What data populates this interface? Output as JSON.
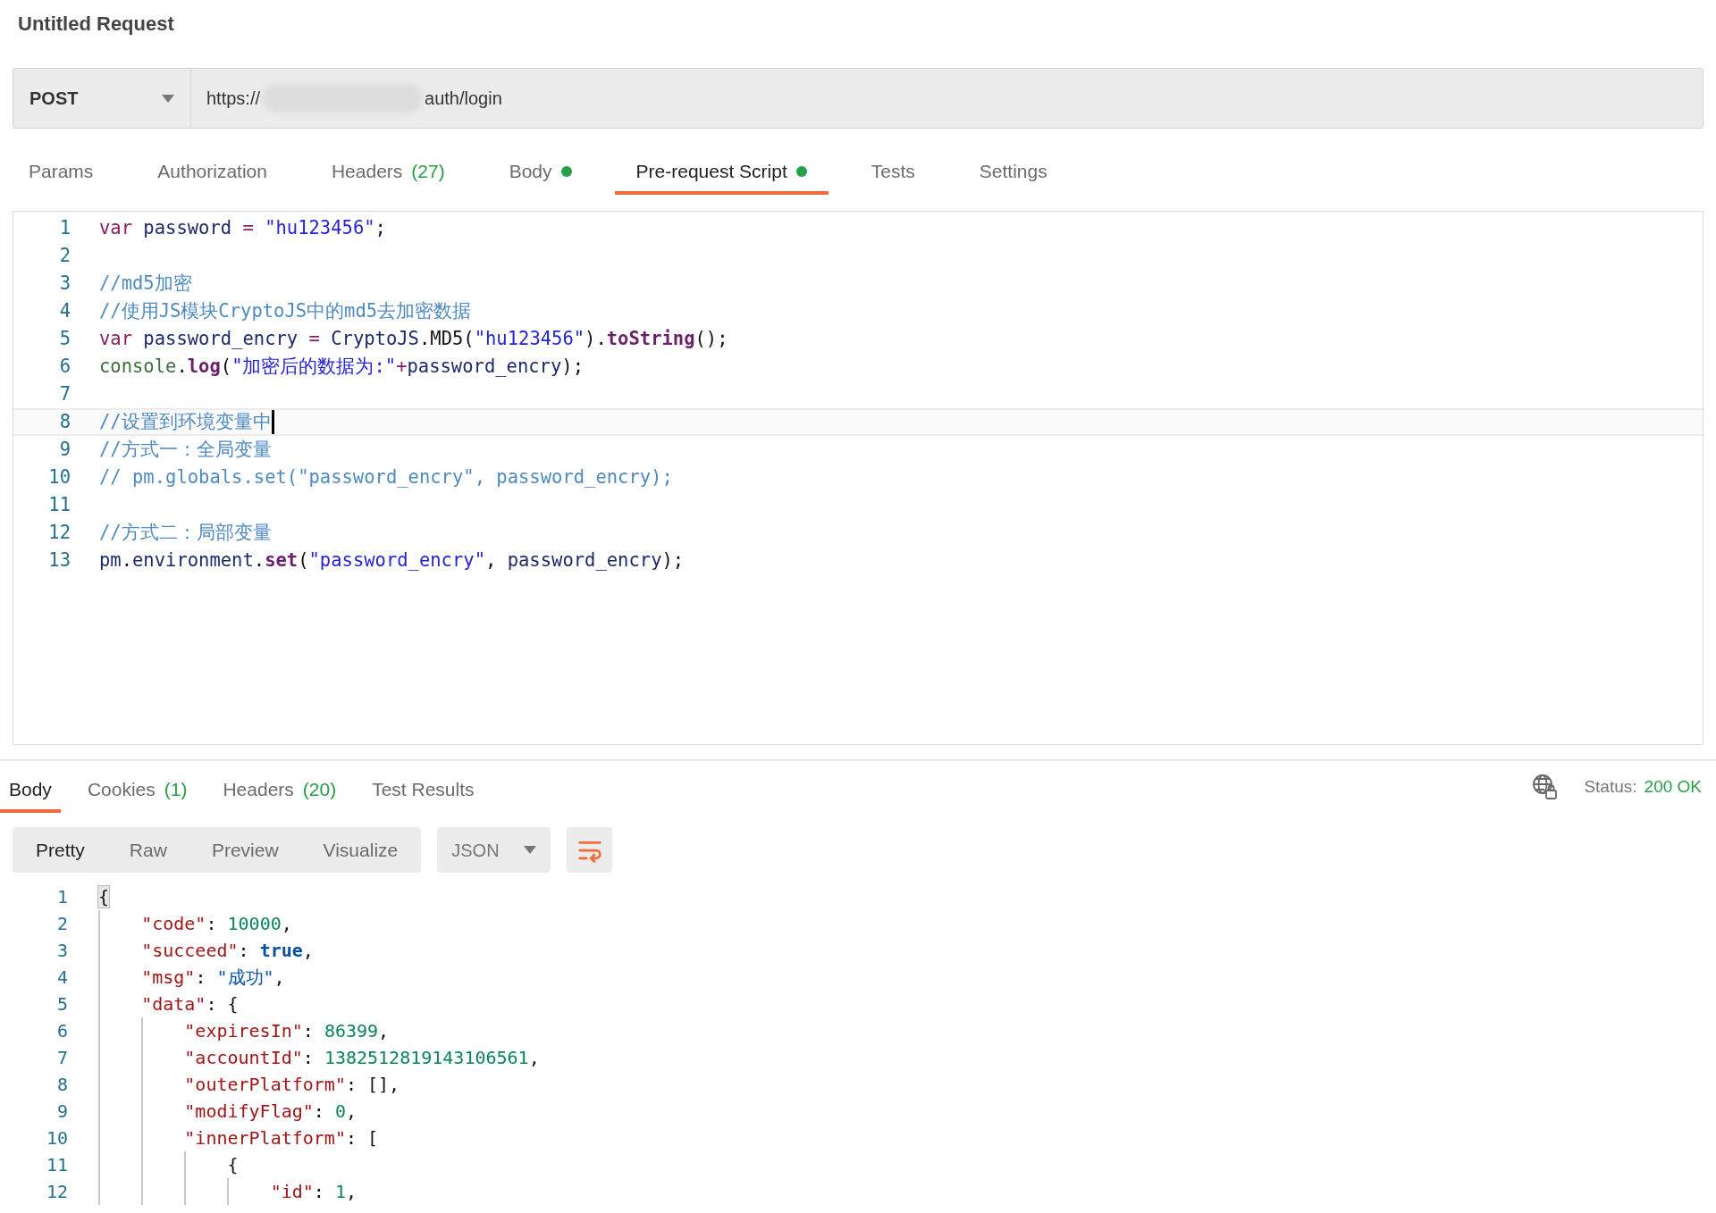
{
  "request": {
    "title": "Untitled Request",
    "method": "POST",
    "url_start": "https://",
    "url_end": "auth/login"
  },
  "request_tabs": [
    {
      "label": "Params",
      "selected": false
    },
    {
      "label": "Authorization",
      "selected": false
    },
    {
      "label": "Headers",
      "count": "(27)",
      "selected": false
    },
    {
      "label": "Body",
      "indicator": true,
      "selected": false
    },
    {
      "label": "Pre-request Script",
      "indicator": true,
      "selected": true
    },
    {
      "label": "Tests",
      "selected": false
    },
    {
      "label": "Settings",
      "selected": false
    }
  ],
  "script_editor": {
    "lines": [
      {
        "number": "1",
        "current": false,
        "tokens": [
          {
            "text": "var",
            "kind": "keyword"
          },
          {
            "text": " password ",
            "kind": "variable"
          },
          {
            "text": "=",
            "kind": "operator"
          },
          {
            "text": " \"hu123456\"",
            "kind": "string"
          },
          {
            "text": ";",
            "kind": "plain"
          }
        ]
      },
      {
        "number": "2",
        "current": false
      },
      {
        "number": "3",
        "current": false,
        "tokens": [
          {
            "text": "//md5加密",
            "kind": "comment"
          }
        ]
      },
      {
        "number": "4",
        "current": false,
        "tokens": [
          {
            "text": "//使用JS模块CryptoJS中的md5去加密数据",
            "kind": "comment"
          }
        ]
      },
      {
        "number": "5",
        "current": false,
        "tokens": [
          {
            "text": "var",
            "kind": "keyword"
          },
          {
            "text": " password_encry ",
            "kind": "variable"
          },
          {
            "text": "=",
            "kind": "operator"
          },
          {
            "text": " CryptoJS",
            "kind": "variable"
          },
          {
            "text": ".MD5(",
            "kind": "plain"
          },
          {
            "text": "\"hu123456\"",
            "kind": "string"
          },
          {
            "text": ").",
            "kind": "plain"
          },
          {
            "text": "toString",
            "kind": "method"
          },
          {
            "text": "();",
            "kind": "plain"
          }
        ]
      },
      {
        "number": "6",
        "current": false,
        "tokens": [
          {
            "text": "console",
            "kind": "builtin"
          },
          {
            "text": ".",
            "kind": "plain"
          },
          {
            "text": "log",
            "kind": "method"
          },
          {
            "text": "(",
            "kind": "plain"
          },
          {
            "text": "\"加密后的数据为:\"",
            "kind": "string"
          },
          {
            "text": "+",
            "kind": "operator"
          },
          {
            "text": "password_encry",
            "kind": "variable"
          },
          {
            "text": ");",
            "kind": "plain"
          }
        ]
      },
      {
        "number": "7",
        "current": false
      },
      {
        "number": "8",
        "current": true,
        "tokens": [
          {
            "text": "//设置到环境变量中",
            "kind": "comment"
          }
        ]
      },
      {
        "number": "9",
        "current": false,
        "tokens": [
          {
            "text": "//方式一：全局变量",
            "kind": "comment"
          }
        ]
      },
      {
        "number": "10",
        "current": false,
        "tokens": [
          {
            "text": "// pm.globals.set(\"password_encry\", password_encry);",
            "kind": "comment"
          }
        ]
      },
      {
        "number": "11",
        "current": false
      },
      {
        "number": "12",
        "current": false,
        "tokens": [
          {
            "text": "//方式二：局部变量",
            "kind": "comment"
          }
        ]
      },
      {
        "number": "13",
        "current": false,
        "tokens": [
          {
            "text": "pm",
            "kind": "variable"
          },
          {
            "text": ".",
            "kind": "plain"
          },
          {
            "text": "environment",
            "kind": "variable"
          },
          {
            "text": ".",
            "kind": "plain"
          },
          {
            "text": "set",
            "kind": "method"
          },
          {
            "text": "(",
            "kind": "plain"
          },
          {
            "text": "\"password_encry\"",
            "kind": "string"
          },
          {
            "text": ", ",
            "kind": "plain"
          },
          {
            "text": "password_encry",
            "kind": "variable"
          },
          {
            "text": ");",
            "kind": "plain"
          }
        ]
      }
    ]
  },
  "response_tabs": [
    {
      "label": "Body",
      "selected": true
    },
    {
      "label": "Cookies",
      "count": "(1)",
      "selected": false
    },
    {
      "label": "Headers",
      "count": "(20)",
      "selected": false
    },
    {
      "label": "Test Results",
      "selected": false
    }
  ],
  "status": {
    "label": "Status:",
    "value": "200 OK"
  },
  "view_modes": [
    {
      "label": "Pretty",
      "selected": true
    },
    {
      "label": "Raw",
      "selected": false
    },
    {
      "label": "Preview",
      "selected": false
    },
    {
      "label": "Visualize",
      "selected": false
    }
  ],
  "format": "JSON",
  "response_body": {
    "lines": [
      {
        "number": "1",
        "tokens": [
          {
            "text": "{",
            "kind": "bracket-match"
          }
        ]
      },
      {
        "number": "2",
        "tokens": [
          {
            "text": "    \"code\"",
            "kind": "key"
          },
          {
            "text": ": ",
            "kind": "punct"
          },
          {
            "text": "10000",
            "kind": "number"
          },
          {
            "text": ",",
            "kind": "punct"
          }
        ]
      },
      {
        "number": "3",
        "tokens": [
          {
            "text": "    \"succeed\"",
            "kind": "key"
          },
          {
            "text": ": ",
            "kind": "punct"
          },
          {
            "text": "true",
            "kind": "bool"
          },
          {
            "text": ",",
            "kind": "punct"
          }
        ]
      },
      {
        "number": "4",
        "tokens": [
          {
            "text": "    \"msg\"",
            "kind": "key"
          },
          {
            "text": ": ",
            "kind": "punct"
          },
          {
            "text": "\"成功\"",
            "kind": "string"
          },
          {
            "text": ",",
            "kind": "punct"
          }
        ]
      },
      {
        "number": "5",
        "tokens": [
          {
            "text": "    \"data\"",
            "kind": "key"
          },
          {
            "text": ": {",
            "kind": "punct"
          }
        ]
      },
      {
        "number": "6",
        "tokens": [
          {
            "text": "        \"expiresIn\"",
            "kind": "key"
          },
          {
            "text": ": ",
            "kind": "punct"
          },
          {
            "text": "86399",
            "kind": "number"
          },
          {
            "text": ",",
            "kind": "punct"
          }
        ]
      },
      {
        "number": "7",
        "tokens": [
          {
            "text": "        \"accountId\"",
            "kind": "key"
          },
          {
            "text": ": ",
            "kind": "punct"
          },
          {
            "text": "1382512819143106561",
            "kind": "number"
          },
          {
            "text": ",",
            "kind": "punct"
          }
        ]
      },
      {
        "number": "8",
        "tokens": [
          {
            "text": "        \"outerPlatform\"",
            "kind": "key"
          },
          {
            "text": ": [],",
            "kind": "punct"
          }
        ]
      },
      {
        "number": "9",
        "tokens": [
          {
            "text": "        \"modifyFlag\"",
            "kind": "key"
          },
          {
            "text": ": ",
            "kind": "punct"
          },
          {
            "text": "0",
            "kind": "number"
          },
          {
            "text": ",",
            "kind": "punct"
          }
        ]
      },
      {
        "number": "10",
        "tokens": [
          {
            "text": "        \"innerPlatform\"",
            "kind": "key"
          },
          {
            "text": ": [",
            "kind": "punct"
          }
        ]
      },
      {
        "number": "11",
        "tokens": [
          {
            "text": "            {",
            "kind": "punct"
          }
        ]
      },
      {
        "number": "12",
        "tokens": [
          {
            "text": "                \"id\"",
            "kind": "key"
          },
          {
            "text": ": ",
            "kind": "punct"
          },
          {
            "text": "1",
            "kind": "number"
          },
          {
            "text": ",",
            "kind": "punct"
          }
        ]
      }
    ]
  }
}
